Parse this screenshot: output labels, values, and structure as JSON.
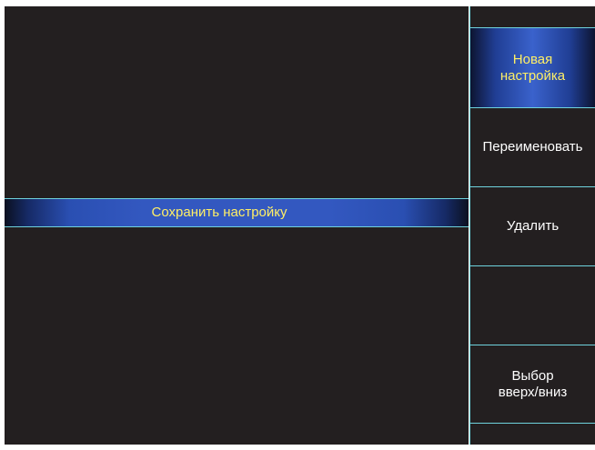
{
  "list": {
    "items": [
      {
        "label": "Сохранить настройку",
        "selected": true
      }
    ]
  },
  "soft_keys": [
    {
      "label": "",
      "selected": false
    },
    {
      "label": "Новая\nнастройка",
      "selected": true
    },
    {
      "label": "Переименовать",
      "selected": false
    },
    {
      "label": "Удалить",
      "selected": false
    },
    {
      "label": "",
      "selected": false
    },
    {
      "label": "Выбор\nвверх/вниз",
      "selected": false
    },
    {
      "label": "",
      "selected": false
    }
  ],
  "colors": {
    "background": "#231f20",
    "border": "#6fd3de",
    "highlight_text": "#ffef66",
    "highlight_bg": "#3358c0",
    "text": "#ffffff"
  }
}
